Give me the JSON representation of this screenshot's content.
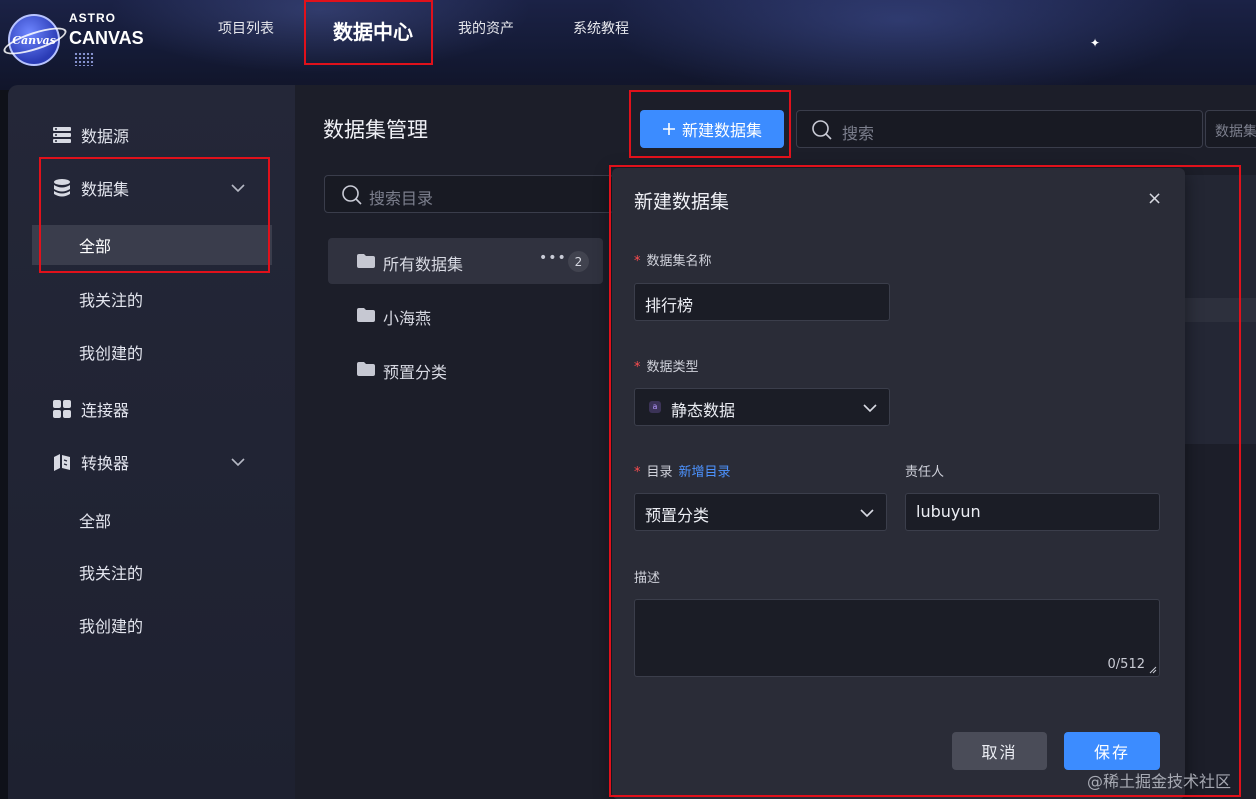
{
  "logo": {
    "badge_text": "Canvas",
    "top_text": "ASTRO",
    "main_text": "CANVAS"
  },
  "topnav": {
    "items": [
      {
        "label": "项目列表"
      },
      {
        "label": "数据中心"
      },
      {
        "label": "我的资产"
      },
      {
        "label": "系统教程"
      }
    ]
  },
  "sidebar": {
    "items": [
      {
        "label": "数据源",
        "icon": "database-stack-icon"
      },
      {
        "label": "数据集",
        "icon": "dataset-icon"
      },
      {
        "label": "连接器",
        "icon": "grid-icon"
      },
      {
        "label": "转换器",
        "icon": "transform-icon"
      }
    ],
    "dataset_sub": [
      {
        "label": "全部"
      },
      {
        "label": "我关注的"
      },
      {
        "label": "我创建的"
      }
    ],
    "converter_sub": [
      {
        "label": "全部"
      },
      {
        "label": "我关注的"
      },
      {
        "label": "我创建的"
      }
    ]
  },
  "main": {
    "title": "数据集管理",
    "new_button": "新建数据集",
    "search_placeholder": "搜索",
    "dataset_select": "数据集",
    "dir_search_placeholder": "搜索目录",
    "tree": [
      {
        "label": "所有数据集",
        "count": "2",
        "more": "•••"
      },
      {
        "label": "小海燕"
      },
      {
        "label": "预置分类"
      }
    ]
  },
  "modal": {
    "title": "新建数据集",
    "close": "×",
    "name_label": "数据集名称",
    "name_value": "排行榜",
    "type_label": "数据类型",
    "type_value": "静态数据",
    "type_icon_text": "a",
    "dir_label": "目录",
    "dir_add_link": "新增目录",
    "dir_value": "预置分类",
    "owner_label": "责任人",
    "owner_value": "lubuyun",
    "desc_label": "描述",
    "desc_counter": "0/512",
    "required_mark": "*",
    "cancel_label": "取消",
    "save_label": "保存"
  },
  "watermark": "@稀土掘金技术社区",
  "colors": {
    "accent": "#3c8cff",
    "highlight_box": "#e0111b",
    "required": "#ff4d4f"
  }
}
